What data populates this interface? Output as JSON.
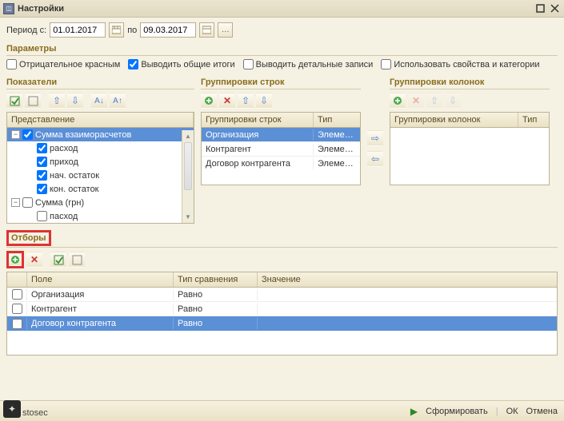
{
  "window": {
    "title": "Настройки"
  },
  "period": {
    "label_from": "Период с:",
    "date_from": "01.01.2017",
    "label_to": "по",
    "date_to": "09.03.2017"
  },
  "params": {
    "title": "Параметры",
    "neg_red": "Отрицательное красным",
    "show_totals": "Выводить общие итоги",
    "show_detail": "Выводить детальные записи",
    "use_props": "Использовать свойства и категории"
  },
  "indicators": {
    "title": "Показатели",
    "header": "Представление",
    "tree": [
      {
        "label": "Сумма взаиморасчетов",
        "level": 0,
        "expanded": true,
        "checked": true,
        "selected": true
      },
      {
        "label": "расход",
        "level": 1,
        "checked": true
      },
      {
        "label": "приход",
        "level": 1,
        "checked": true
      },
      {
        "label": "нач. остаток",
        "level": 1,
        "checked": true
      },
      {
        "label": "кон. остаток",
        "level": 1,
        "checked": true
      },
      {
        "label": "Сумма (грн)",
        "level": 0,
        "expanded": true,
        "checked": false
      },
      {
        "label": "пасход",
        "level": 1,
        "checked": false
      }
    ]
  },
  "row_groups": {
    "title": "Группировки строк",
    "header_group": "Группировки строк",
    "header_type": "Тип",
    "rows": [
      {
        "group": "Организация",
        "type": "Элемен...",
        "selected": true
      },
      {
        "group": "Контрагент",
        "type": "Элемен..."
      },
      {
        "group": "Договор контрагента",
        "type": "Элемен..."
      }
    ]
  },
  "col_groups": {
    "title": "Группировки колонок",
    "header_group": "Группировки колонок",
    "header_type": "Тип"
  },
  "filters": {
    "title": "Отборы",
    "header_field": "Поле",
    "header_comp": "Тип сравнения",
    "header_val": "Значение",
    "rows": [
      {
        "field": "Организация",
        "comp": "Равно"
      },
      {
        "field": "Контрагент",
        "comp": "Равно"
      },
      {
        "field": "Договор контрагента",
        "comp": "Равно",
        "selected": true
      }
    ]
  },
  "footer": {
    "form": "Сформировать",
    "ok": "ОК",
    "cancel": "Отмена"
  },
  "brand": "stosec"
}
